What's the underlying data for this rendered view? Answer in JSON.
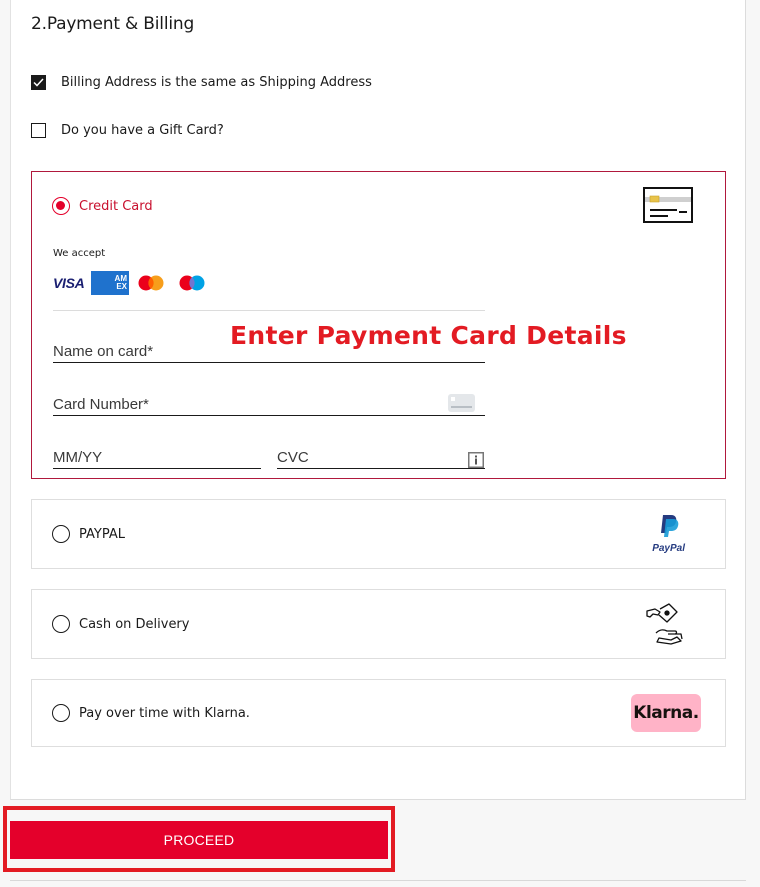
{
  "section": {
    "title": "2.Payment & Billing"
  },
  "options": {
    "billing_same": {
      "label": "Billing Address is the same as Shipping Address",
      "checked": true
    },
    "gift_card": {
      "label": "Do you have a Gift Card?",
      "checked": false
    }
  },
  "payment_methods": {
    "credit_card": {
      "label": "Credit Card",
      "selected": true,
      "we_accept": "We accept",
      "accepted_cards": [
        "visa-logo",
        "amex-logo",
        "mastercard-logo",
        "maestro-logo"
      ],
      "visa_text": "VISA",
      "amex_text_top": "AM",
      "amex_text_bottom": "EX",
      "fields": {
        "name_placeholder": "Name on card*",
        "number_placeholder": "Card Number*",
        "expiry_placeholder": "MM/YY",
        "cvc_placeholder": "CVC"
      },
      "annotation": "Enter Payment Card Details"
    },
    "paypal": {
      "label": "PAYPAL",
      "selected": false,
      "logo_text": "PayPal"
    },
    "cod": {
      "label": "Cash on Delivery",
      "selected": false
    },
    "klarna": {
      "label": "Pay over time with Klarna.",
      "selected": false,
      "logo_text": "Klarna."
    }
  },
  "proceed": {
    "label": "PROCEED"
  },
  "colors": {
    "brand_red": "#e4002b",
    "selected_border": "#b0183c",
    "annotation_red": "#e31b23",
    "klarna_pink": "#ffb3c7"
  }
}
